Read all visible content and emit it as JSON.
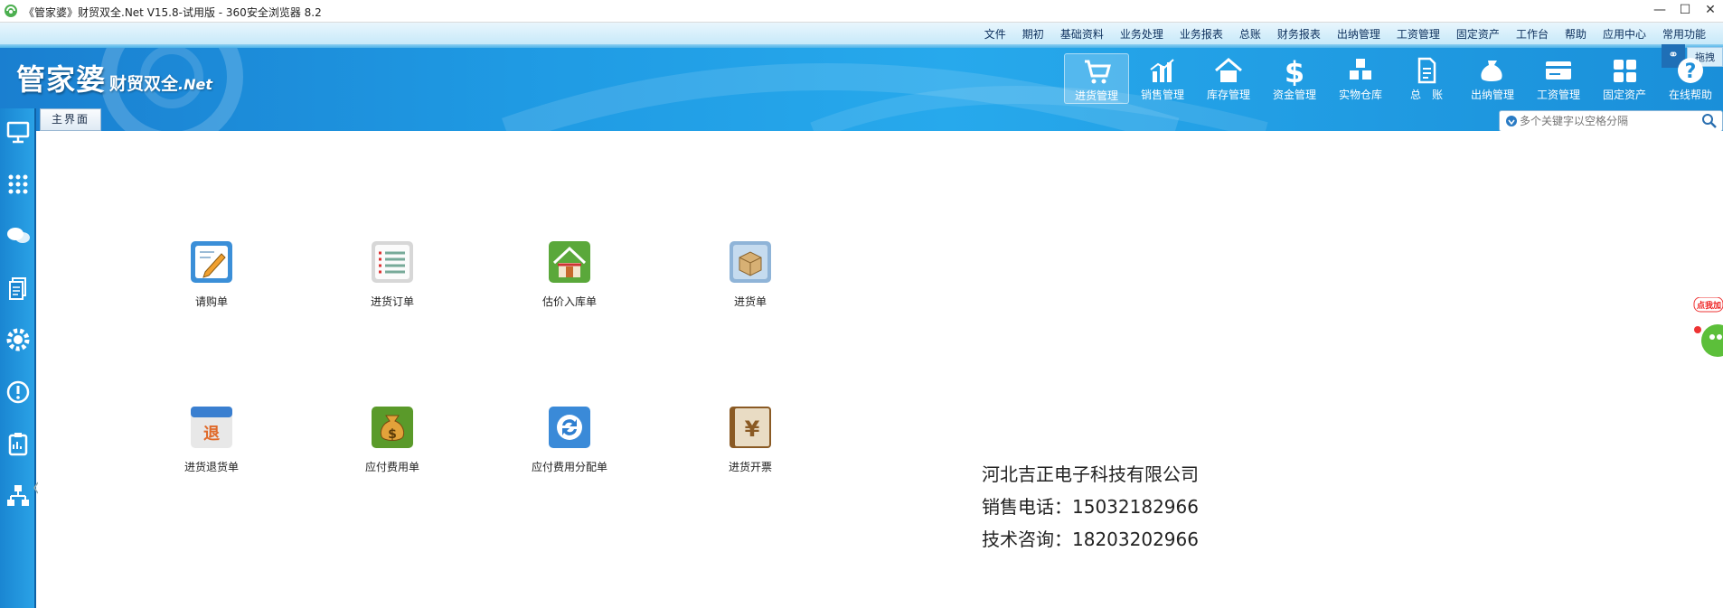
{
  "window": {
    "title": "《管家婆》财贸双全.Net V15.8-试用版 - 360安全浏览器 8.2",
    "min_label": "—",
    "max_label": "☐",
    "close_label": "✕"
  },
  "menu": [
    "文件",
    "期初",
    "基础资料",
    "业务处理",
    "业务报表",
    "总账",
    "财务报表",
    "出纳管理",
    "工资管理",
    "固定资产",
    "工作台",
    "帮助",
    "应用中心",
    "常用功能"
  ],
  "header": {
    "brand_main": "管家婆",
    "brand_sub": "财贸双全",
    "brand_net": ".Net",
    "corner_tab": "拖拽"
  },
  "toolbar": [
    {
      "label": "进货管理",
      "icon": "cart-icon",
      "active": true
    },
    {
      "label": "销售管理",
      "icon": "bar-chart-icon"
    },
    {
      "label": "库存管理",
      "icon": "house-icon"
    },
    {
      "label": "资金管理",
      "icon": "dollar-icon"
    },
    {
      "label": "实物仓库",
      "icon": "boxes-icon"
    },
    {
      "label": "总　账",
      "icon": "ledger-icon"
    },
    {
      "label": "出纳管理",
      "icon": "money-bag-icon"
    },
    {
      "label": "工资管理",
      "icon": "card-icon"
    },
    {
      "label": "固定资产",
      "icon": "grid-icon"
    },
    {
      "label": "在线帮助",
      "icon": "question-icon"
    }
  ],
  "tabs": {
    "main": "主界面"
  },
  "search": {
    "placeholder": "多个关键字以空格分隔"
  },
  "sidebar": [
    "monitor-icon",
    "apps-grid-icon",
    "chat-icon",
    "documents-icon",
    "settings-icon",
    "alert-icon",
    "clipboard-icon",
    "network-icon"
  ],
  "tiles_row1": [
    {
      "label": "请购单",
      "icon": "request-form-icon"
    },
    {
      "label": "进货订单",
      "icon": "purchase-order-icon"
    },
    {
      "label": "估价入库单",
      "icon": "warehouse-entry-icon"
    },
    {
      "label": "进货单",
      "icon": "goods-box-icon"
    }
  ],
  "tiles_row2": [
    {
      "label": "进货退货单",
      "icon": "return-icon"
    },
    {
      "label": "应付费用单",
      "icon": "payable-bag-icon"
    },
    {
      "label": "应付费用分配单",
      "icon": "allocation-refresh-icon"
    },
    {
      "label": "进货开票",
      "icon": "invoice-book-icon"
    }
  ],
  "company": {
    "name": "河北吉正电子科技有限公司",
    "sales": "销售电话：15032182966",
    "support": "技术咨询：18203202966"
  },
  "float_ad": {
    "label": "点我加"
  },
  "colors": {
    "header": "#1f9ae3",
    "sidebar": "#1a86d2",
    "menu_text": "#0c2f5c"
  }
}
